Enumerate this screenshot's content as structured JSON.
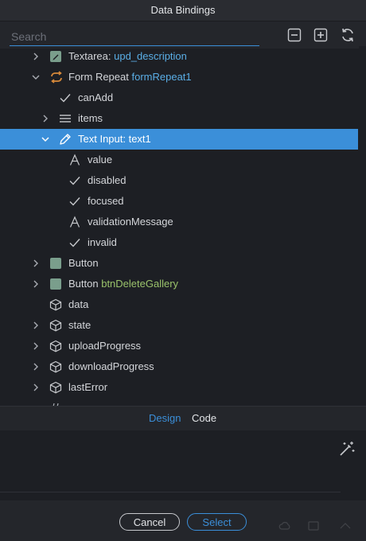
{
  "title": "Data Bindings",
  "search": {
    "placeholder": "Search"
  },
  "tree": {
    "rows": [
      {
        "label": "Textarea:",
        "id": "upd_description"
      },
      {
        "label": "Form Repeat",
        "id": "formRepeat1"
      },
      {
        "label": "canAdd"
      },
      {
        "label": "items"
      },
      {
        "label": "Text Input: text1"
      },
      {
        "label": "value"
      },
      {
        "label": "disabled"
      },
      {
        "label": "focused"
      },
      {
        "label": "validationMessage"
      },
      {
        "label": "invalid"
      },
      {
        "label": "Button"
      },
      {
        "label": "Button",
        "id": "btnDeleteGallery"
      },
      {
        "label": "data"
      },
      {
        "label": "state"
      },
      {
        "label": "uploadProgress"
      },
      {
        "label": "downloadProgress"
      },
      {
        "label": "lastError"
      }
    ]
  },
  "tabs": {
    "design": "Design",
    "code": "Code"
  },
  "footer": {
    "cancel": "Cancel",
    "select": "Select"
  },
  "colors": {
    "accent": "#3b8fd9",
    "background": "#1d1f24",
    "panel": "#24262b",
    "green_id": "#9ac26b"
  }
}
